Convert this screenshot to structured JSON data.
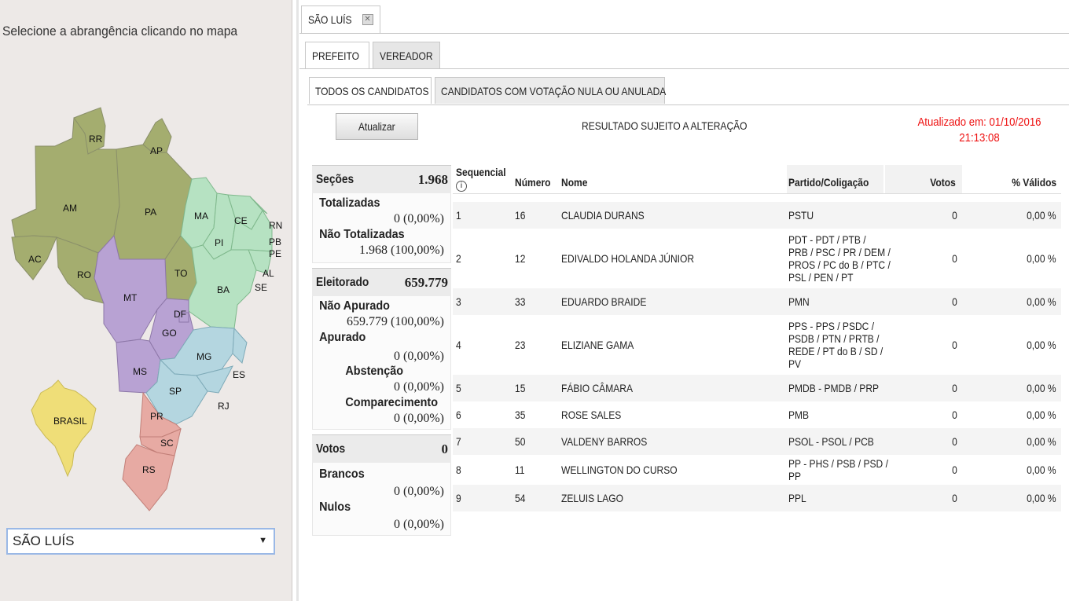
{
  "left_panel": {
    "instruction": "Selecione a abrangência clicando no mapa",
    "map": {
      "states": [
        "RR",
        "AP",
        "AM",
        "PA",
        "MA",
        "CE",
        "RN",
        "PB",
        "PE",
        "AL",
        "SE",
        "PI",
        "AC",
        "RO",
        "TO",
        "BA",
        "MT",
        "DF",
        "GO",
        "MG",
        "ES",
        "MS",
        "SP",
        "RJ",
        "PR",
        "SC",
        "RS"
      ],
      "national_label": "BRASIL"
    },
    "city_select": {
      "value": "SÃO LUÍS"
    }
  },
  "tabs": {
    "city": "SÃO LUÍS",
    "office": [
      "PREFEITO",
      "VEREADOR"
    ],
    "candidates": [
      "TODOS OS CANDIDATOS",
      "CANDIDATOS COM VOTAÇÃO NULA OU ANULADA"
    ]
  },
  "toolbar": {
    "update_button": "Atualizar",
    "notice": "RESULTADO SUJEITO A ALTERAÇÃO",
    "updated_line1": "Atualizado em: 01/10/2016",
    "updated_line2": "21:13:08"
  },
  "stats": {
    "secoes": {
      "label": "Seções",
      "value": "1.968"
    },
    "totalizadas": {
      "label": "Totalizadas",
      "value": "0 (0,00%)"
    },
    "nao_totalizadas": {
      "label": "Não Totalizadas",
      "value": "1.968 (100,00%)"
    },
    "eleitorado": {
      "label": "Eleitorado",
      "value": "659.779"
    },
    "nao_apurado": {
      "label": "Não Apurado",
      "value": "659.779 (100,00%)"
    },
    "apurado": {
      "label": "Apurado",
      "value": "0 (0,00%)"
    },
    "abstencao": {
      "label": "Abstenção",
      "value": "0 (0,00%)"
    },
    "comparecimento": {
      "label": "Comparecimento",
      "value": "0 (0,00%)"
    },
    "votos": {
      "label": "Votos",
      "value": "0"
    },
    "brancos": {
      "label": "Brancos",
      "value": "0 (0,00%)"
    },
    "nulos": {
      "label": "Nulos",
      "value": "0 (0,00%)"
    }
  },
  "table": {
    "headers": {
      "seq": "Sequencial",
      "seq_info": "i",
      "num": "Número",
      "nome": "Nome",
      "partido": "Partido/Coligação",
      "votos": "Votos",
      "validos": "% Válidos"
    },
    "rows": [
      {
        "seq": "1",
        "num": "16",
        "nome": "CLAUDIA DURANS",
        "partido": [
          "PSTU"
        ],
        "votos": "0",
        "validos": "0,00 %"
      },
      {
        "seq": "2",
        "num": "12",
        "nome": "EDIVALDO HOLANDA JÚNIOR",
        "partido": [
          "PDT - PDT / PTB /",
          "PRB / PSC / PR / DEM /",
          "PROS / PC do B / PTC /",
          "PSL / PEN / PT"
        ],
        "votos": "0",
        "validos": "0,00 %"
      },
      {
        "seq": "3",
        "num": "33",
        "nome": "EDUARDO BRAIDE",
        "partido": [
          "PMN"
        ],
        "votos": "0",
        "validos": "0,00 %"
      },
      {
        "seq": "4",
        "num": "23",
        "nome": "ELIZIANE GAMA",
        "partido": [
          "PPS - PPS / PSDC /",
          "PSDB / PTN / PRTB /",
          "REDE / PT do B / SD /",
          "PV"
        ],
        "votos": "0",
        "validos": "0,00 %"
      },
      {
        "seq": "5",
        "num": "15",
        "nome": "FÁBIO CÂMARA",
        "partido": [
          "PMDB - PMDB / PRP"
        ],
        "votos": "0",
        "validos": "0,00 %"
      },
      {
        "seq": "6",
        "num": "35",
        "nome": "ROSE SALES",
        "partido": [
          "PMB"
        ],
        "votos": "0",
        "validos": "0,00 %"
      },
      {
        "seq": "7",
        "num": "50",
        "nome": "VALDENY BARROS",
        "partido": [
          "PSOL - PSOL / PCB"
        ],
        "votos": "0",
        "validos": "0,00 %"
      },
      {
        "seq": "8",
        "num": "11",
        "nome": "WELLINGTON DO CURSO",
        "partido": [
          "PP - PHS / PSB / PSD /",
          "PP"
        ],
        "votos": "0",
        "validos": "0,00 %"
      },
      {
        "seq": "9",
        "num": "54",
        "nome": "ZELUIS LAGO",
        "partido": [
          "PPL"
        ],
        "votos": "0",
        "validos": "0,00 %"
      }
    ]
  }
}
